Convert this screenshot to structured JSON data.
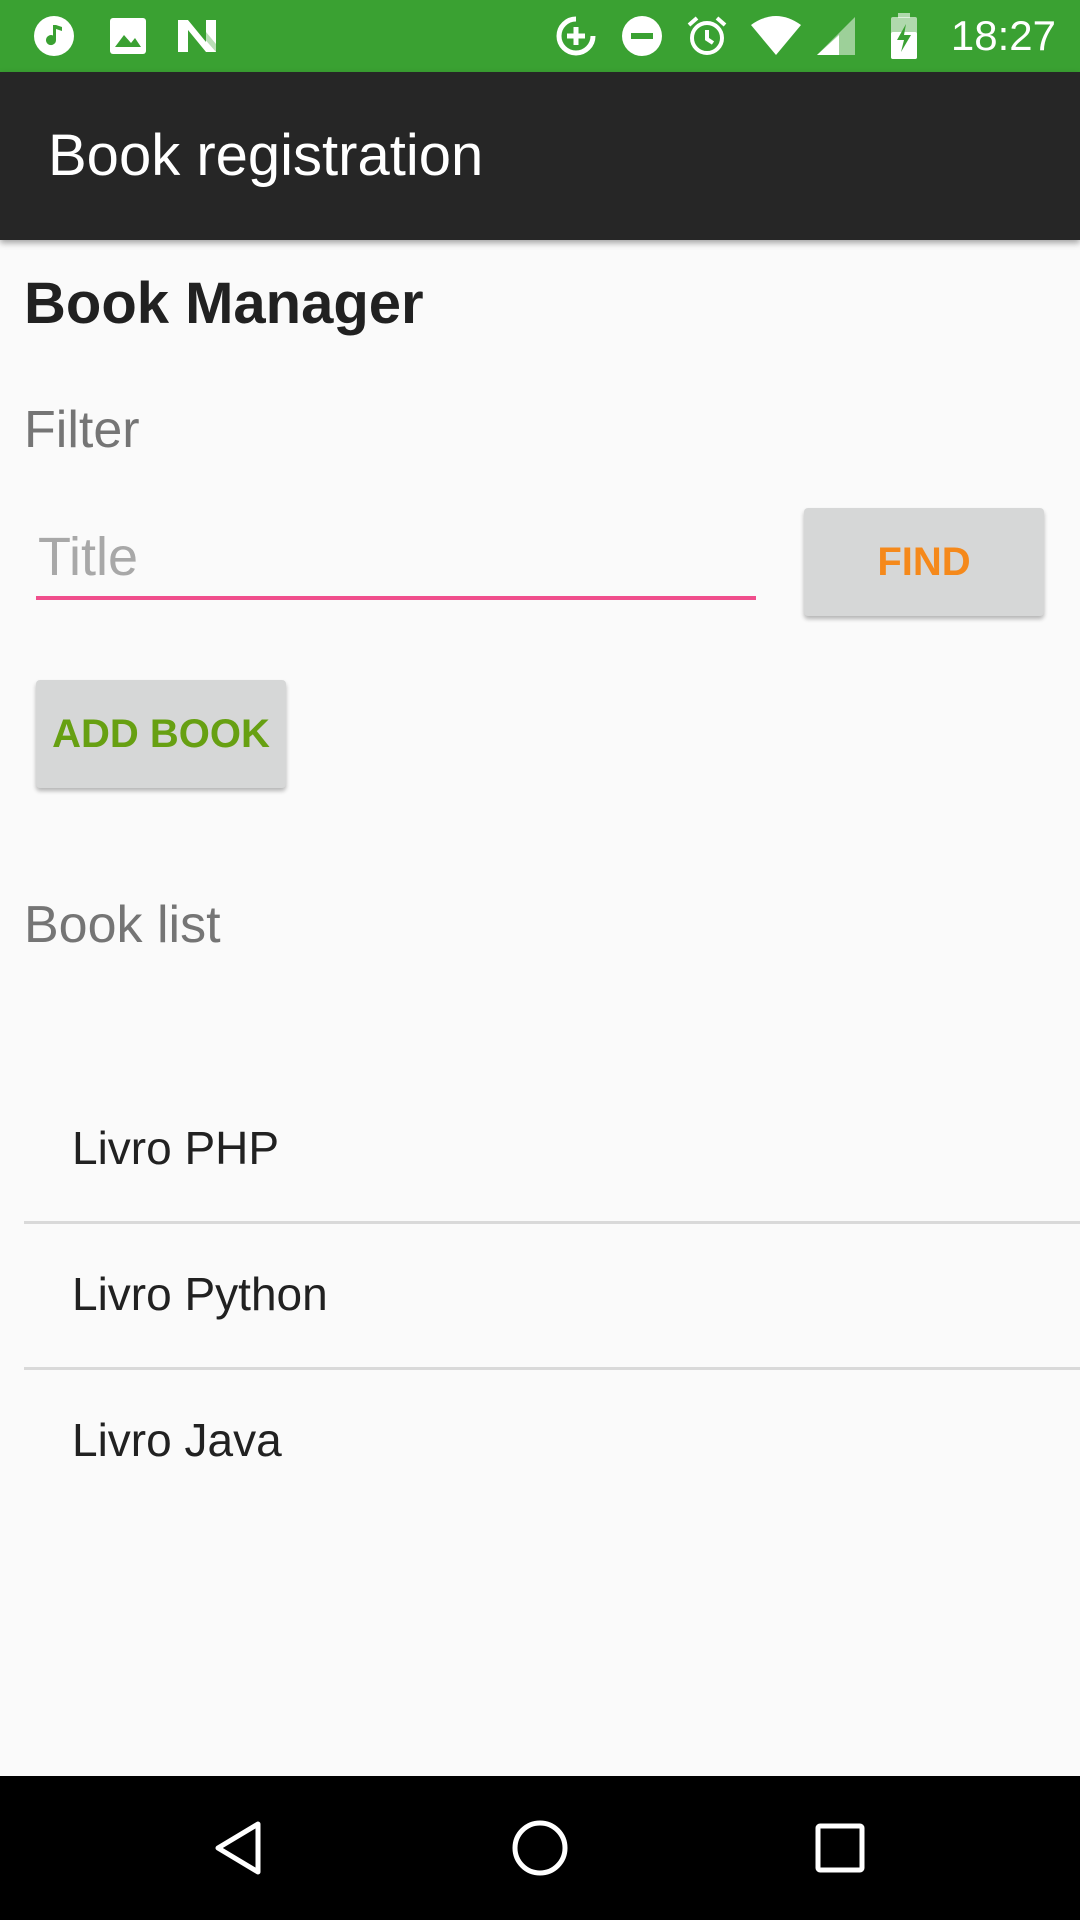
{
  "status_bar": {
    "time": "18:27",
    "bg_color": "#3aa132",
    "left_icons": [
      "music-note-icon",
      "image-icon",
      "n-logo-icon"
    ],
    "right_icons": [
      "data-saver-icon",
      "do-not-disturb-icon",
      "alarm-icon",
      "wifi-icon",
      "cell-signal-icon",
      "battery-charging-icon"
    ]
  },
  "app_bar": {
    "title": "Book registration",
    "bg_color": "#262626"
  },
  "main": {
    "heading": "Book Manager",
    "filter_label": "Filter",
    "title_input": {
      "placeholder": "Title",
      "value": ""
    },
    "find_button": "FIND",
    "add_book_button": "ADD BOOK",
    "book_list_label": "Book list",
    "books": [
      "Livro PHP",
      "Livro Python",
      "Livro Java"
    ]
  },
  "colors": {
    "accent_input": "#f04e8c",
    "find_text": "#f5891b",
    "add_text": "#67a012",
    "button_bg": "#d6d7d7"
  },
  "nav_bar": {
    "icons": [
      "back-icon",
      "home-icon",
      "recents-icon"
    ]
  }
}
